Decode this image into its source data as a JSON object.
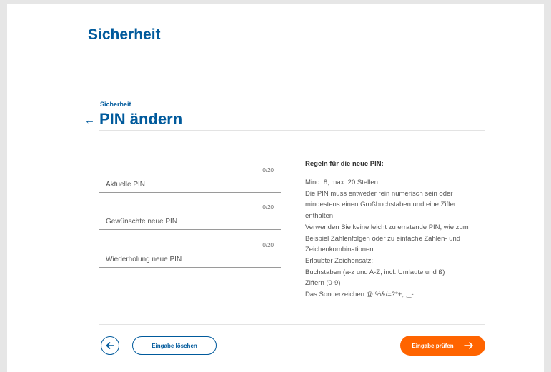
{
  "header": {
    "app_title": "Sicherheit"
  },
  "page": {
    "breadcrumb": "Sicherheit",
    "back_icon": "arrow-left-icon",
    "title": "PIN ändern"
  },
  "form": {
    "fields": [
      {
        "placeholder": "Aktuelle PIN",
        "counter": "0/20",
        "value": ""
      },
      {
        "placeholder": "Gewünschte neue PIN",
        "counter": "0/20",
        "value": ""
      },
      {
        "placeholder": "Wiederholung neue PIN",
        "counter": "0/20",
        "value": ""
      }
    ]
  },
  "rules": {
    "title": "Regeln für die neue PIN:",
    "lines": [
      "Mind. 8, max. 20 Stellen.",
      "Die PIN muss entweder rein numerisch sein oder",
      "mindestens einen Großbuchstaben und eine Ziffer",
      "enthalten.",
      "Verwenden Sie keine leicht zu erratende PIN, wie zum",
      "Beispiel Zahlenfolgen oder zu einfache Zahlen- und",
      "Zeichenkombinationen.",
      "Erlaubter Zeichensatz:",
      "Buchstaben (a-z und A-Z, incl. Umlaute und ß)",
      "Ziffern (0-9)",
      "Das Sonderzeichen @!%&/=?*+;:,_-"
    ]
  },
  "footer": {
    "back_icon": "arrow-left-circle-icon",
    "clear_label": "Eingabe löschen",
    "submit_label": "Eingabe prüfen",
    "submit_icon": "arrow-right-icon"
  },
  "colors": {
    "brand_blue": "#005a9c",
    "accent_orange": "#ff6400"
  }
}
